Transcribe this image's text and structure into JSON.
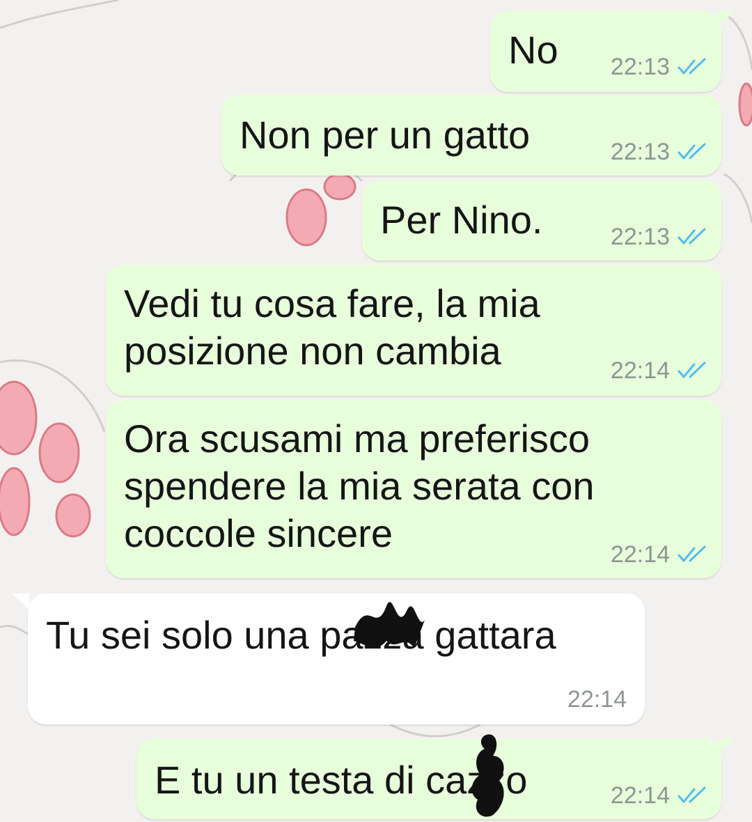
{
  "colors": {
    "outgoing_bubble": "#e7ffdb",
    "incoming_bubble": "#ffffff",
    "timestamp": "#8e9592",
    "read_ticks": "#53bdeb"
  },
  "messages": [
    {
      "direction": "out",
      "text": "No",
      "time": "22:13",
      "status_icon": "double-check-read-icon"
    },
    {
      "direction": "out",
      "text": "Non per un gatto",
      "time": "22:13",
      "status_icon": "double-check-read-icon"
    },
    {
      "direction": "out",
      "text": "Per Nino.",
      "time": "22:13",
      "status_icon": "double-check-read-icon"
    },
    {
      "direction": "out",
      "text": "Vedi tu cosa fare, la mia\nposizione non cambia",
      "time": "22:14",
      "status_icon": "double-check-read-icon"
    },
    {
      "direction": "out",
      "text": "Ora scusami ma preferisco\nspendere la mia serata con\ncoccole sincere",
      "time": "22:14",
      "status_icon": "double-check-read-icon"
    },
    {
      "direction": "in",
      "text": "Tu sei solo una pazza gattara",
      "time": "22:14"
    },
    {
      "direction": "out",
      "text": "E tu un testa di cazzo",
      "time": "22:14",
      "status_icon": "double-check-read-icon"
    }
  ]
}
